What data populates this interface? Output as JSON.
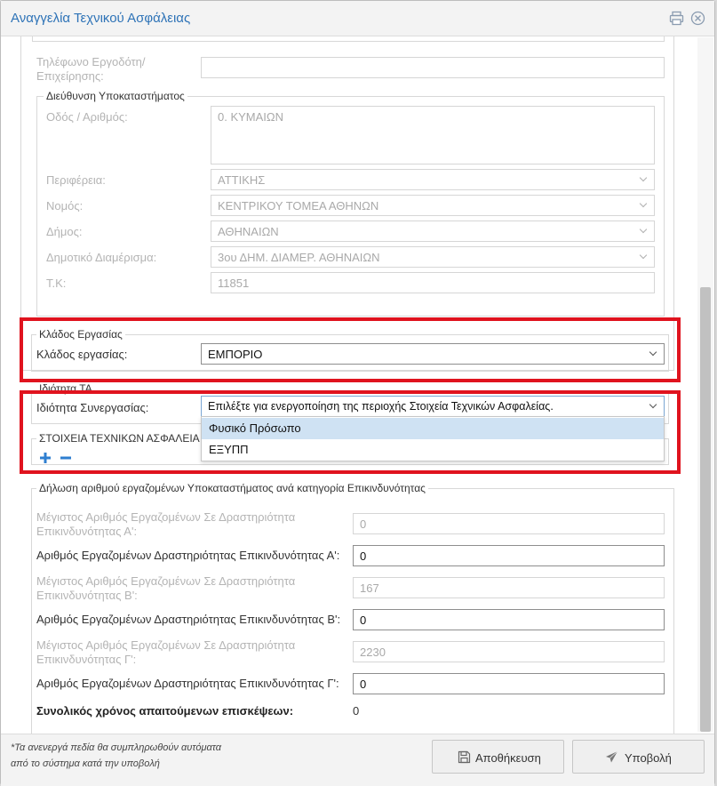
{
  "dialog": {
    "title": "Αναγγελία Τεχνικού Ασφάλειας",
    "icons": {
      "print": "print-icon",
      "close": "close-icon"
    }
  },
  "employer": {
    "phone_label": "Τηλέφωνο Εργοδότη/ Επιχείρησης:",
    "phone_value": ""
  },
  "branch_address": {
    "legend": "Διεύθυνση Υποκαταστήματος",
    "street_label": "Οδός / Αριθμός:",
    "street_value": "0. ΚΥΜΑΙΩΝ",
    "region_label": "Περιφέρεια:",
    "region_value": "ΑΤΤΙΚΗΣ",
    "prefecture_label": "Νομός:",
    "prefecture_value": "ΚΕΝΤΡΙΚΟΥ ΤΟΜΕΑ ΑΘΗΝΩΝ",
    "municipality_label": "Δήμος:",
    "municipality_value": "ΑΘΗΝΑΙΩΝ",
    "district_label": "Δημοτικό Διαμέρισμα:",
    "district_value": "3ου ΔΗΜ. ΔΙΑΜΕΡ. ΑΘΗΝΑΙΩΝ",
    "postcode_label": "Τ.Κ:",
    "postcode_value": "11851"
  },
  "work_sector": {
    "legend": "Κλάδος Εργασίας",
    "label": "Κλάδος εργασίας:",
    "value": "ΕΜΠΟΡΙΟ"
  },
  "ta_property": {
    "legend": "Ιδιότητα ΤΑ",
    "label": "Ιδιότητα Συνεργασίας:",
    "value": "Επιλέξτε για ενεργοποίηση της περιοχής Στοιχεία Τεχνικών Ασφαλείας.",
    "options": [
      "Φυσικό Πρόσωπο",
      "ΕΞΥΠΠ"
    ]
  },
  "ta_details": {
    "legend": "ΣΤΟΙΧΕΙΑ ΤΕΧΝΙΚΩΝ ΑΣΦΑΛΕΙΑ",
    "icons": {
      "add": "plus-icon",
      "remove": "minus-icon"
    }
  },
  "employees": {
    "legend": "Δήλωση αριθμού εργαζομένων Υποκαταστήματος ανά κατηγορία Επικινδυνότητας",
    "max_a_label": "Μέγιστος Αριθμός Εργαζομένων Σε Δραστηριότητα Επικινδυνότητας Α':",
    "max_a_value": "0",
    "num_a_label": "Αριθμός Εργαζομένων Δραστηριότητας Επικινδυνότητας Α':",
    "num_a_value": "0",
    "max_b_label": "Μέγιστος Αριθμός Εργαζομένων Σε Δραστηριότητα Επικινδυνότητας Β':",
    "max_b_value": "167",
    "num_b_label": "Αριθμός Εργαζομένων Δραστηριότητας Επικινδυνότητας Β':",
    "num_b_value": "0",
    "max_c_label": "Μέγιστος Αριθμός Εργαζομένων Σε Δραστηριότητα Επικινδυνότητας Γ':",
    "max_c_value": "2230",
    "num_c_label": "Αριθμός Εργαζομένων Δραστηριότητας Επικινδυνότητας Γ':",
    "num_c_value": "0",
    "total_label": "Συνολικός χρόνος απαιτούμενων επισκέψεων:",
    "total_value": "0"
  },
  "footer": {
    "note_line1": "*Τα ανενεργά πεδία θα συμπληρωθούν αυτόματα",
    "note_line2": "από το σύστημα κατά την υποβολή",
    "save_label": "Αποθήκευση",
    "submit_label": "Υποβολή",
    "icons": {
      "save": "floppy-icon",
      "submit": "paper-plane-icon"
    }
  },
  "colors": {
    "accent": "#2e73b7",
    "highlight_border": "#e0131e",
    "option_highlight": "#cfe2f3"
  }
}
